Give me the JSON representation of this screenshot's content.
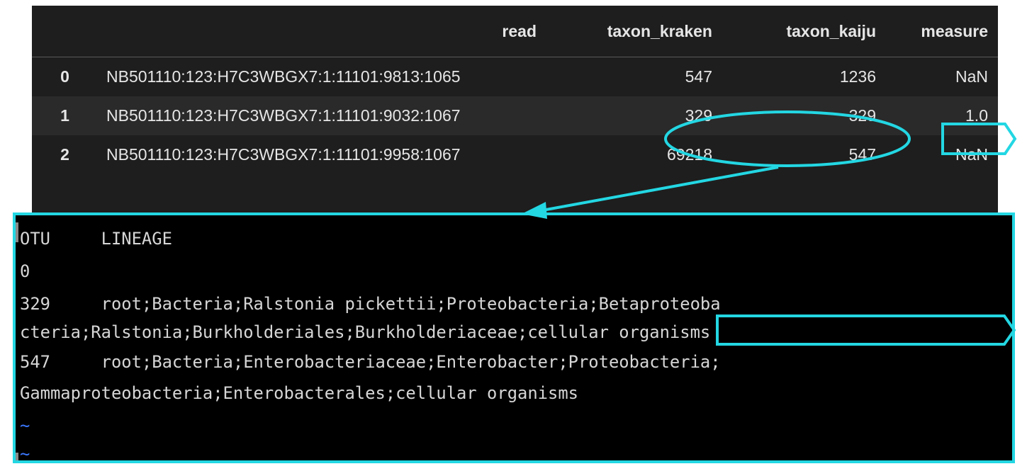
{
  "dataframe": {
    "columns": [
      "",
      "read",
      "taxon_kraken",
      "taxon_kaiju",
      "measure"
    ],
    "rows": [
      {
        "index": "0",
        "read": "NB501110:123:H7C3WBGX7:1:11101:9813:1065",
        "taxon_kraken": "547",
        "taxon_kaiju": "1236",
        "measure": "NaN"
      },
      {
        "index": "1",
        "read": "NB501110:123:H7C3WBGX7:1:11101:9032:1067",
        "taxon_kraken": "329",
        "taxon_kaiju": "329",
        "measure": "1.0"
      },
      {
        "index": "2",
        "read": "NB501110:123:H7C3WBGX7:1:11101:9958:1067",
        "taxon_kraken": "69218",
        "taxon_kaiju": "547",
        "measure": "NaN"
      }
    ]
  },
  "terminal": {
    "lines": [
      "OTU     LINEAGE",
      "0",
      "329     root;Bacteria;Ralstonia pickettii;Proteobacteria;Betaproteoba",
      "cteria;Ralstonia;Burkholderiales;Burkholderiaceae;cellular organisms",
      "547     root;Bacteria;Enterobacteriaceae;Enterobacter;Proteobacteria;",
      "Gammaproteobacteria;Enterobacterales;cellular organisms"
    ],
    "tilde_lines": [
      "~",
      "~"
    ]
  },
  "colors": {
    "annotation": "#23d7e3",
    "dataframe_bg": "#1e1e1e",
    "terminal_bg": "#000000",
    "tilde": "#3b78ff"
  }
}
